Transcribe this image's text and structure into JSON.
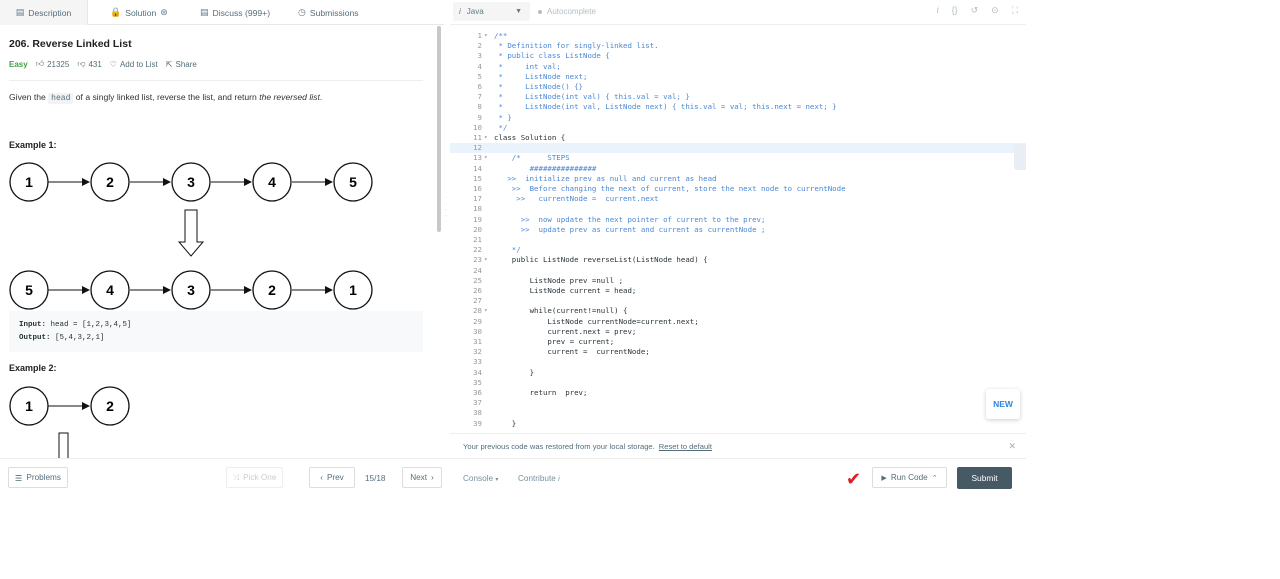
{
  "tabs": {
    "description": "Description",
    "solution": "Solution",
    "discuss": "Discuss (999+)",
    "submissions": "Submissions"
  },
  "problem": {
    "title": "206. Reverse Linked List",
    "difficulty": "Easy",
    "likes": "21325",
    "dislikes": "431",
    "add_to_list": "Add to List",
    "share": "Share",
    "desc_pre": "Given the ",
    "desc_code": "head",
    "desc_mid": " of a singly linked list, reverse the list, and return ",
    "desc_em": "the reversed list",
    "desc_post": ".",
    "example1_title": "Example 1:",
    "example2_title": "Example 2:",
    "example1_top": [
      "1",
      "2",
      "3",
      "4",
      "5"
    ],
    "example1_bottom": [
      "5",
      "4",
      "3",
      "2",
      "1"
    ],
    "example2_top": [
      "1",
      "2"
    ],
    "input_label": "Input:",
    "input_value": "head = [1,2,3,4,5]",
    "output_label": "Output:",
    "output_value": "[5,4,3,2,1]"
  },
  "editor": {
    "language": "Java",
    "language_icon": "i",
    "autocomplete": "Autocomplete",
    "toolbar_icons": [
      "info-icon",
      "braces-icon",
      "reset-icon",
      "settings-icon",
      "fullscreen-icon"
    ],
    "lines": [
      {
        "n": "1",
        "fold": "▾",
        "text": "/**",
        "cls": "c"
      },
      {
        "n": "2",
        "fold": "",
        "text": " * Definition for singly-linked list.",
        "cls": "c"
      },
      {
        "n": "3",
        "fold": "",
        "text": " * public class ListNode {",
        "cls": "c"
      },
      {
        "n": "4",
        "fold": "",
        "text": " *     int val;",
        "cls": "c"
      },
      {
        "n": "5",
        "fold": "",
        "text": " *     ListNode next;",
        "cls": "c"
      },
      {
        "n": "6",
        "fold": "",
        "text": " *     ListNode() {}",
        "cls": "c"
      },
      {
        "n": "7",
        "fold": "",
        "text": " *     ListNode(int val) { this.val = val; }",
        "cls": "c"
      },
      {
        "n": "8",
        "fold": "",
        "text": " *     ListNode(int val, ListNode next) { this.val = val; this.next = next; }",
        "cls": "c"
      },
      {
        "n": "9",
        "fold": "",
        "text": " * }",
        "cls": "c"
      },
      {
        "n": "10",
        "fold": "",
        "text": " */",
        "cls": "c"
      },
      {
        "n": "11",
        "fold": "▾",
        "text": "class Solution {",
        "cls": "t"
      },
      {
        "n": "12",
        "fold": "",
        "text": "",
        "cls": "t"
      },
      {
        "n": "13",
        "fold": "▾",
        "text": "    /*      STEPS",
        "cls": "c"
      },
      {
        "n": "14",
        "fold": "",
        "text": "        ###############",
        "cls": "c"
      },
      {
        "n": "15",
        "fold": "",
        "text": "   >>  initialize prev as null and current as head",
        "cls": "c"
      },
      {
        "n": "16",
        "fold": "",
        "text": "    >>  Before changing the next of current, store the next node to currentNode",
        "cls": "c"
      },
      {
        "n": "17",
        "fold": "",
        "text": "     >>   currentNode =  current.next",
        "cls": "c"
      },
      {
        "n": "18",
        "fold": "",
        "text": "",
        "cls": "c"
      },
      {
        "n": "19",
        "fold": "",
        "text": "      >>  now update the next pointer of current to the prev;",
        "cls": "c"
      },
      {
        "n": "20",
        "fold": "",
        "text": "      >>  update prev as current and current as currentNode ;",
        "cls": "c"
      },
      {
        "n": "21",
        "fold": "",
        "text": "",
        "cls": "c"
      },
      {
        "n": "22",
        "fold": "",
        "text": "    */",
        "cls": "c"
      },
      {
        "n": "23",
        "fold": "▾",
        "text": "    public ListNode reverseList(ListNode head) {",
        "cls": "t"
      },
      {
        "n": "24",
        "fold": "",
        "text": "",
        "cls": "t"
      },
      {
        "n": "25",
        "fold": "",
        "text": "        ListNode prev =null ;",
        "cls": "t"
      },
      {
        "n": "26",
        "fold": "",
        "text": "        ListNode current = head;",
        "cls": "t"
      },
      {
        "n": "27",
        "fold": "",
        "text": "",
        "cls": "t"
      },
      {
        "n": "28",
        "fold": "▾",
        "text": "        while(current!=null) {",
        "cls": "t"
      },
      {
        "n": "29",
        "fold": "",
        "text": "            ListNode currentNode=current.next;",
        "cls": "t"
      },
      {
        "n": "30",
        "fold": "",
        "text": "            current.next = prev;",
        "cls": "t"
      },
      {
        "n": "31",
        "fold": "",
        "text": "            prev = current;",
        "cls": "t"
      },
      {
        "n": "32",
        "fold": "",
        "text": "            current =  currentNode;",
        "cls": "t"
      },
      {
        "n": "33",
        "fold": "",
        "text": "",
        "cls": "t"
      },
      {
        "n": "34",
        "fold": "",
        "text": "        }",
        "cls": "t"
      },
      {
        "n": "35",
        "fold": "",
        "text": "",
        "cls": "t"
      },
      {
        "n": "36",
        "fold": "",
        "text": "        return  prev;",
        "cls": "t"
      },
      {
        "n": "37",
        "fold": "",
        "text": "",
        "cls": "t"
      },
      {
        "n": "38",
        "fold": "",
        "text": "",
        "cls": "t"
      },
      {
        "n": "39",
        "fold": "",
        "text": "    }",
        "cls": "t"
      }
    ],
    "new_badge": "NEW",
    "restore_msg": "Your previous code was restored from your local storage.",
    "restore_link": "Reset to default"
  },
  "bottom": {
    "problems": "Problems",
    "pick_one": "Pick One",
    "prev": "Prev",
    "page": "15/18",
    "next": "Next",
    "console": "Console",
    "contribute": "Contribute",
    "run_code": "Run Code",
    "submit": "Submit"
  },
  "colors": {
    "easy": "#43a047",
    "submit_bg": "#455a64",
    "check": "#e01b1b",
    "comment": "#4a87d5"
  }
}
